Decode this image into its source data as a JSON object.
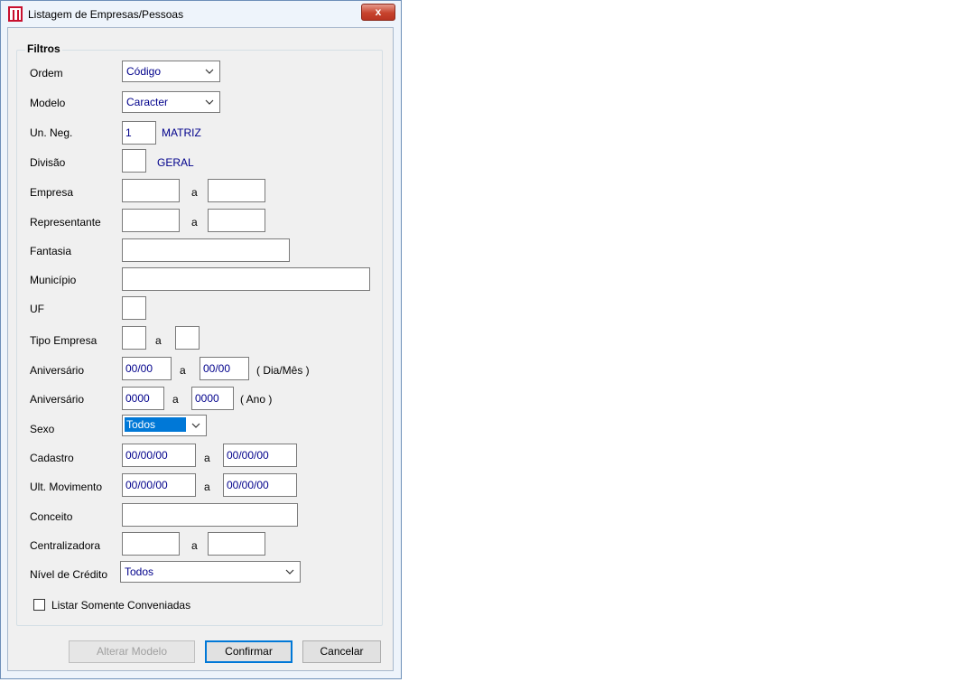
{
  "window": {
    "title": "Listagem de Empresas/Pessoas",
    "close_label": "x"
  },
  "group": {
    "title": "Filtros"
  },
  "labels": {
    "ordem": "Ordem",
    "modelo": "Modelo",
    "un_neg": "Un. Neg.",
    "divisao": "Divisão",
    "empresa": "Empresa",
    "representante": "Representante",
    "fantasia": "Fantasia",
    "municipio": "Município",
    "uf": "UF",
    "tipo_empresa": "Tipo Empresa",
    "aniversario_dm": "Aniversário",
    "aniversario_ano": "Aniversário",
    "sexo": "Sexo",
    "cadastro": "Cadastro",
    "ult_movimento": "Ult. Movimento",
    "conceito": "Conceito",
    "centralizadora": "Centralizadora",
    "nivel_credito": "Nível de Crédito"
  },
  "fields": {
    "ordem": "Código",
    "modelo": "Caracter",
    "un_neg": "1",
    "un_neg_desc": "MATRIZ",
    "divisao": "",
    "divisao_desc": "GERAL",
    "aniversario_dm_from": "00/00",
    "aniversario_dm_to": "00/00",
    "aniversario_dm_hint": "( Dia/Mês )",
    "aniversario_ano_from": "0000",
    "aniversario_ano_to": "0000",
    "aniversario_ano_hint": "( Ano )",
    "sexo": "Todos",
    "cadastro_from": "00/00/00",
    "cadastro_to": "00/00/00",
    "ult_mov_from": "00/00/00",
    "ult_mov_to": "00/00/00",
    "nivel_credito": "Todos"
  },
  "range_sep": "a",
  "checkbox": {
    "label": "Listar Somente Conveniadas",
    "checked": false
  },
  "buttons": {
    "alterar": "Alterar Modelo",
    "confirmar": "Confirmar",
    "cancelar": "Cancelar"
  },
  "colors": {
    "value_text": "#00008b",
    "selection": "#0078d7",
    "close": "#c7432d"
  }
}
